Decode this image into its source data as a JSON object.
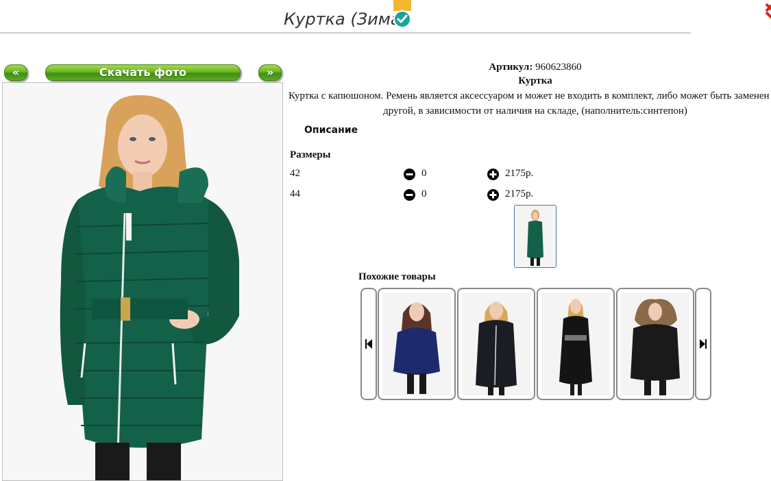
{
  "header": {
    "title": "Куртка (Зима)",
    "badge_icon": "check-circle-icon",
    "badge_color": "#f3b82e"
  },
  "gallery": {
    "prev_label": "«",
    "download_label": "Скачать фото",
    "next_label": "»",
    "accent_color": "#5aa520"
  },
  "product": {
    "article_label": "Артикул:",
    "article_value": "960623860",
    "name": "Куртка",
    "description": "Куртка с капюшоном. Ремень является аксессуаром и может не входить в комплект, либо может быть заменен на другой, в зависимости от наличия на складе, (наполнитель:синтепон)",
    "description_heading": "Описание",
    "sizes_heading": "Размеры",
    "sizes": [
      {
        "size": "42",
        "qty": "0",
        "price": "2175р."
      },
      {
        "size": "44",
        "qty": "0",
        "price": "2175р."
      }
    ]
  },
  "similar": {
    "heading": "Похожие товары",
    "items": [
      {
        "color": "#1d2a6e"
      },
      {
        "color": "#1b1d24"
      },
      {
        "color": "#141414"
      },
      {
        "color": "#1a1a1a"
      }
    ]
  }
}
